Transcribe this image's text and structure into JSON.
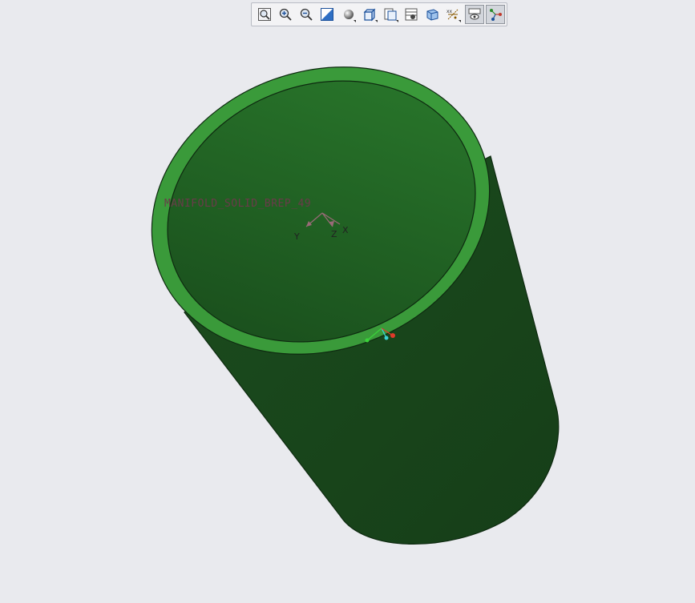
{
  "toolbar": {
    "buttons": [
      {
        "icon": "refit-icon",
        "active": false,
        "flyout": false
      },
      {
        "icon": "zoom-in-icon",
        "active": false,
        "flyout": false
      },
      {
        "icon": "zoom-out-icon",
        "active": false,
        "flyout": false
      },
      {
        "icon": "repaint-icon",
        "active": false,
        "flyout": false
      },
      {
        "icon": "display-style-icon",
        "active": false,
        "flyout": true
      },
      {
        "icon": "saved-orientations-icon",
        "active": false,
        "flyout": true
      },
      {
        "icon": "view-manager-icon",
        "active": false,
        "flyout": true
      },
      {
        "icon": "appearance-gallery-icon",
        "active": false,
        "flyout": false
      },
      {
        "icon": "perspective-view-icon",
        "active": false,
        "flyout": false
      },
      {
        "icon": "datum-display-icon",
        "active": false,
        "flyout": true
      },
      {
        "icon": "annotation-display-icon",
        "active": true,
        "flyout": false
      },
      {
        "icon": "spin-center-icon",
        "active": true,
        "flyout": false
      }
    ]
  },
  "model": {
    "csys_label": "MANIFOLD_SOLID_BREP_49",
    "axis_labels": {
      "x": "X",
      "y": "Y",
      "z": "Z"
    },
    "colors": {
      "outer_surface": "#1d4a1f",
      "rim": "#3a9a3a",
      "inner_surface": "#226a28",
      "edge": "#0e2a10",
      "background": "#e9eaee"
    }
  }
}
